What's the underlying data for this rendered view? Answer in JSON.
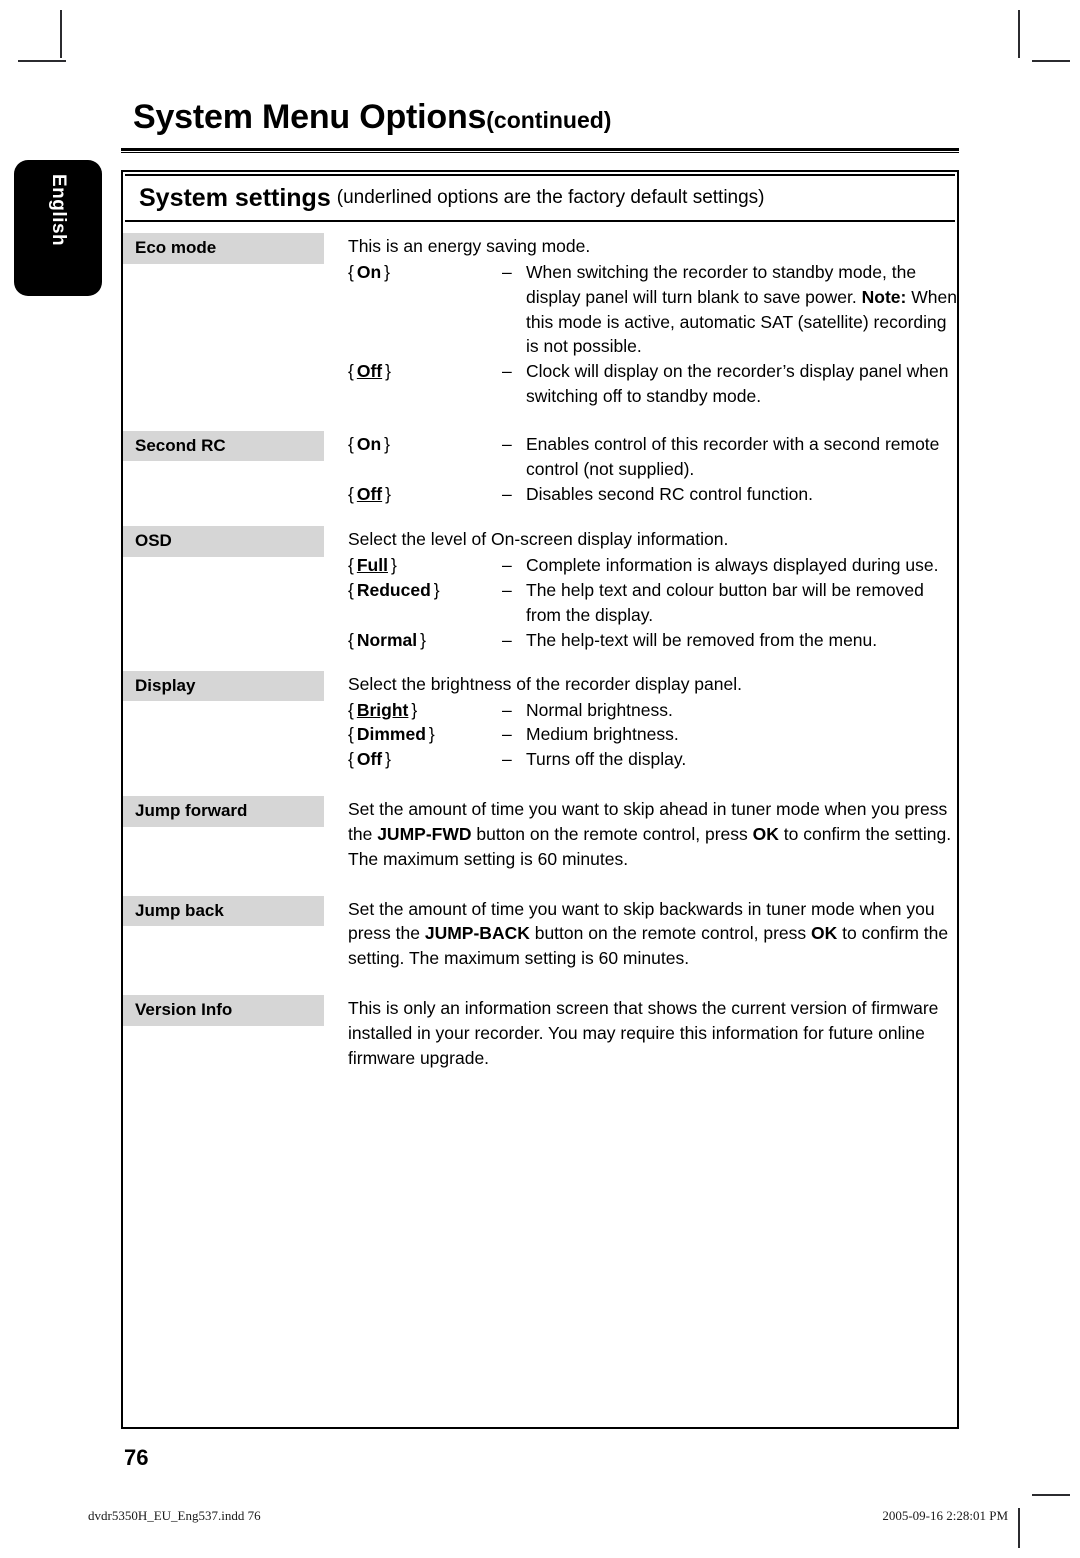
{
  "language_tab": {
    "label": "English"
  },
  "heading": {
    "title": "System Menu Options",
    "continued": "(continued)"
  },
  "section": {
    "title": "System settings",
    "note": "(underlined options are the factory default settings)"
  },
  "footer": {
    "page_number": "76",
    "file_name": "dvdr5350H_EU_Eng537.indd   76",
    "timestamp": "2005-09-16   2:28:01 PM"
  },
  "colors": {
    "label_background": "#d6d6d6",
    "tab_background": "#000000",
    "tab_text": "#ffffff",
    "rule": "#000000"
  },
  "settings": [
    {
      "label": "Eco mode",
      "intro": "This is an energy saving mode.",
      "options": [
        {
          "key": "On",
          "is_default": false,
          "description": "When switching the recorder to standby mode, the display panel will turn blank to save power.",
          "note_label": "Note:",
          "note_text": "When this mode is active, automatic SAT (satellite) recording is not possible."
        },
        {
          "key": "Off",
          "is_default": true,
          "description": "Clock will display on the recorder’s display panel when switching off to standby mode."
        }
      ]
    },
    {
      "label": "Second RC",
      "intro": "",
      "options": [
        {
          "key": "On",
          "is_default": false,
          "description": "Enables control of this recorder with a second remote control (not supplied)."
        },
        {
          "key": "Off",
          "is_default": true,
          "description": "Disables second RC control function."
        }
      ]
    },
    {
      "label": "OSD",
      "intro": "Select the level of On-screen display information.",
      "options": [
        {
          "key": "Full",
          "is_default": true,
          "description": "Complete information is always displayed during use."
        },
        {
          "key": "Reduced",
          "is_default": false,
          "description": "The help text and colour button bar will be removed from the display."
        },
        {
          "key": "Normal",
          "is_default": false,
          "description": "The help-text will be removed from the menu."
        }
      ]
    },
    {
      "label": "Display",
      "intro": "Select the brightness of the recorder display panel.",
      "options": [
        {
          "key": "Bright",
          "is_default": true,
          "description": "Normal brightness."
        },
        {
          "key": "Dimmed",
          "is_default": false,
          "description": "Medium brightness."
        },
        {
          "key": "Off",
          "is_default": false,
          "description": "Turns off the display."
        }
      ]
    },
    {
      "label": "Jump forward",
      "paragraph_parts": [
        {
          "text": "Set the amount of time you want to skip ahead in tuner mode when you press the ",
          "bold": false
        },
        {
          "text": "JUMP-FWD",
          "bold": true
        },
        {
          "text": " button on the remote control, press ",
          "bold": false
        },
        {
          "text": "OK",
          "bold": true
        },
        {
          "text": " to confirm the setting. The maximum setting is 60 minutes.",
          "bold": false
        }
      ]
    },
    {
      "label": "Jump back",
      "paragraph_parts": [
        {
          "text": "Set the amount of time you want to skip backwards in tuner mode when you press the ",
          "bold": false
        },
        {
          "text": "JUMP-BACK",
          "bold": true
        },
        {
          "text": " button on the remote control, press ",
          "bold": false
        },
        {
          "text": "OK",
          "bold": true
        },
        {
          "text": " to confirm the setting. The maximum setting is 60 minutes.",
          "bold": false
        }
      ]
    },
    {
      "label": "Version Info",
      "paragraph_parts": [
        {
          "text": "This is only an information screen that shows the current version of firmware installed in your recorder. You may require this information for future online firmware upgrade.",
          "bold": false
        }
      ]
    }
  ]
}
